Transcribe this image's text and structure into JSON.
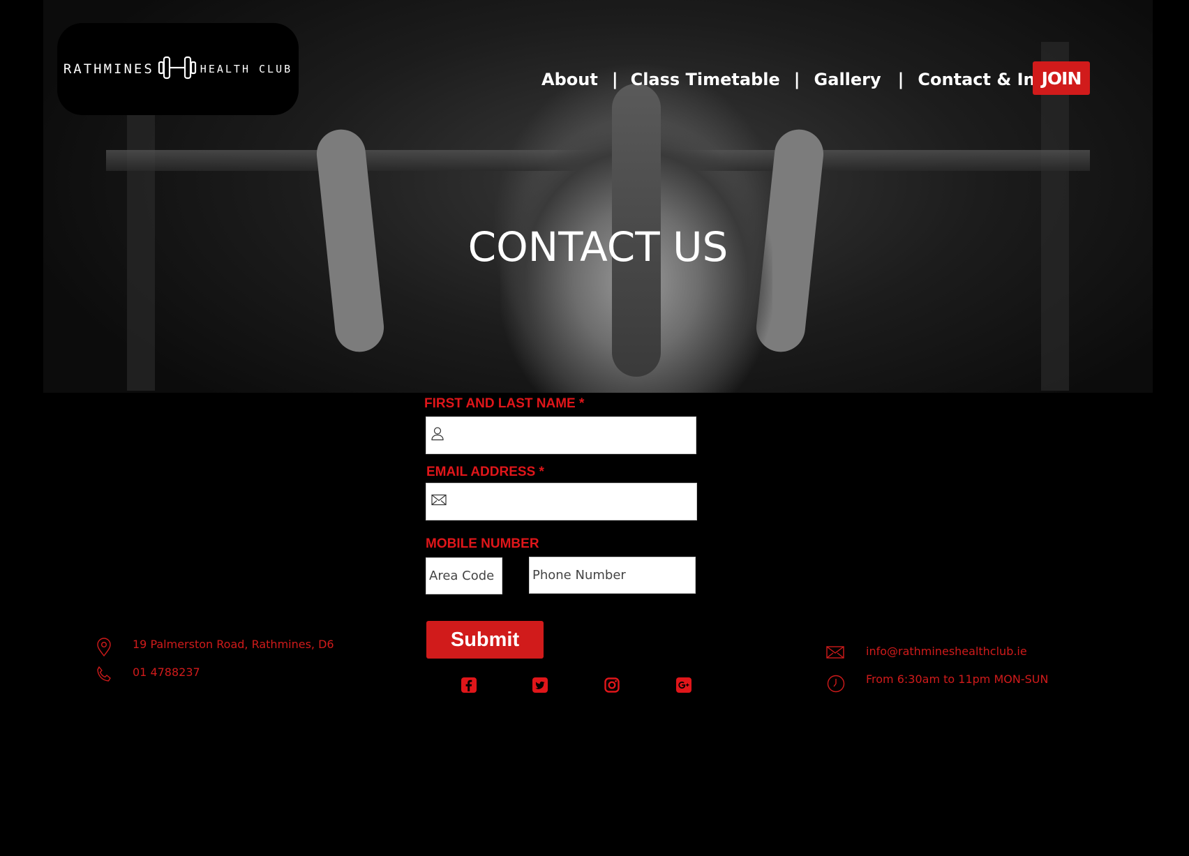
{
  "brand": {
    "logo_left": "RATHMINES",
    "logo_right": "HEALTH CLUB"
  },
  "nav": {
    "items": [
      "About",
      "Class Timetable",
      "Gallery",
      "Contact & Info"
    ],
    "separator": "|",
    "join_label": "JOIN"
  },
  "hero": {
    "title": "CONTACT US"
  },
  "form": {
    "name_label": "FIRST AND LAST  NAME *",
    "name_icon": "user-icon",
    "email_label": "EMAIL ADDRESS *",
    "email_icon": "envelope-icon",
    "mobile_label": "MOBILE NUMBER",
    "area_code_placeholder": "Area Code",
    "phone_placeholder": "Phone Number",
    "submit_label": "Submit"
  },
  "social": [
    "facebook-icon",
    "twitter-icon",
    "instagram-icon",
    "google-plus-icon"
  ],
  "contact_info": {
    "address": "19 Palmerston Road, Rathmines, D6",
    "phone": "01 4788237",
    "email": "info@rathmineshealthclub.ie",
    "hours": "From 6:30am to 11pm MON-SUN"
  },
  "colors": {
    "accent": "#d11b1b",
    "background": "#000000",
    "text_on_dark": "#ffffff"
  }
}
